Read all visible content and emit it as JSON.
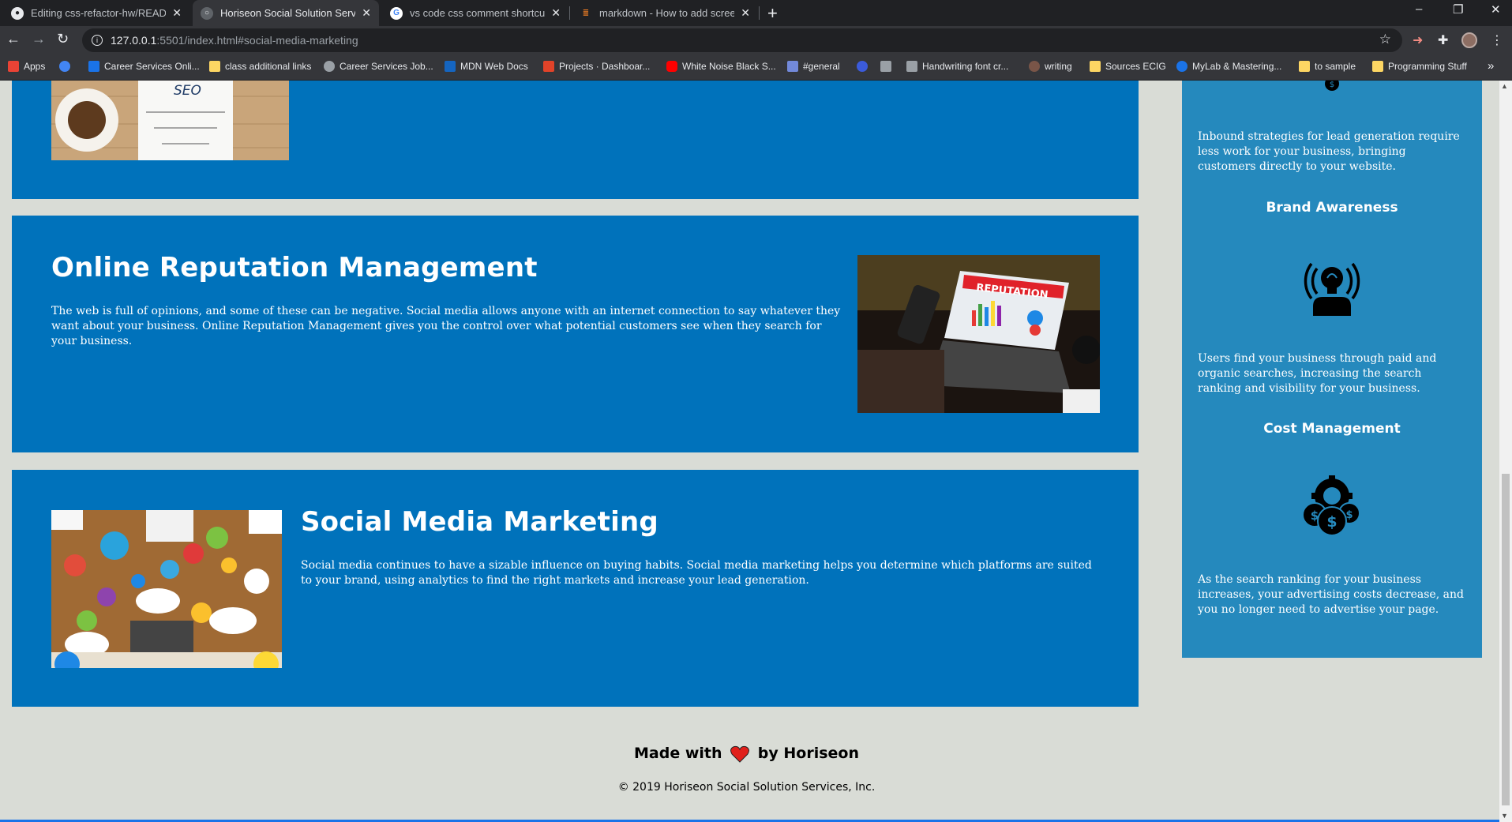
{
  "browser": {
    "tabs": [
      {
        "label": "Editing css-refactor-hw/README",
        "icon": "github-icon"
      },
      {
        "label": "Horiseon Social Solution Services",
        "icon": "globe-icon"
      },
      {
        "label": "vs code css comment shortcut - C",
        "icon": "google-icon"
      },
      {
        "label": "markdown - How to add screensh",
        "icon": "stackoverflow-icon"
      }
    ],
    "address": {
      "host": "127.0.0.1",
      "rest": ":5501/index.html#social-media-marketing"
    },
    "bookmarks": [
      {
        "label": "Apps",
        "color": "#ea4335"
      },
      {
        "label": "",
        "color": "#4285f4"
      },
      {
        "label": "Career Services Onli...",
        "color": "#1a73e8"
      },
      {
        "label": "class additional links",
        "color": "#fdd663"
      },
      {
        "label": "Career Services Job...",
        "color": "#9aa0a6"
      },
      {
        "label": "MDN Web Docs",
        "color": "#1565c0"
      },
      {
        "label": "Projects · Dashboar...",
        "color": "#e24329"
      },
      {
        "label": "White Noise Black S...",
        "color": "#ff0000"
      },
      {
        "label": "#general",
        "color": "#7289da"
      },
      {
        "label": "",
        "color": "#3b5bdb"
      },
      {
        "label": "",
        "color": "#9aa0a6"
      },
      {
        "label": "Handwriting font cr...",
        "color": "#9aa0a6"
      },
      {
        "label": "writing",
        "color": "#795548"
      },
      {
        "label": "Sources ECIG",
        "color": "#fdd663"
      },
      {
        "label": "MyLab & Mastering...",
        "color": "#1a73e8"
      },
      {
        "label": "to sample",
        "color": "#fdd663"
      },
      {
        "label": "Programming Stuff",
        "color": "#fdd663"
      }
    ]
  },
  "sections": {
    "reputation": {
      "title": "Online Reputation Management",
      "body": "The web is full of opinions, and some of these can be negative. Social media allows anyone with an internet connection to say whatever they want about your business. Online Reputation Management gives you the control over what potential customers see when they search for your business.",
      "image_label": "REPUTATION"
    },
    "social": {
      "title": "Social Media Marketing",
      "body": "Social media continues to have a sizable influence on buying habits. Social media marketing helps you determine which platforms are suited to your brand, using analytics to find the right markets and increase your lead generation."
    },
    "seo_image_text": "SEO"
  },
  "aside": {
    "lead_gen_text": "Inbound strategies for lead generation require less work for your business, bringing customers directly to your website.",
    "brand": {
      "title": "Brand Awareness",
      "text": "Users find your business through paid and organic searches, increasing the search ranking and visibility for your business."
    },
    "cost": {
      "title": "Cost Management",
      "text": "As the search ranking for your business increases, your advertising costs decrease, and you no longer need to advertise your page."
    }
  },
  "footer": {
    "made_with": "Made with",
    "by": "by Horiseon",
    "copyright": "© 2019 Horiseon Social Solution Services, Inc."
  },
  "colors": {
    "section_blue": "#0072bb",
    "aside_blue": "#2589bd",
    "page_bg": "#d9dcd6",
    "heart": "#e0201b"
  }
}
